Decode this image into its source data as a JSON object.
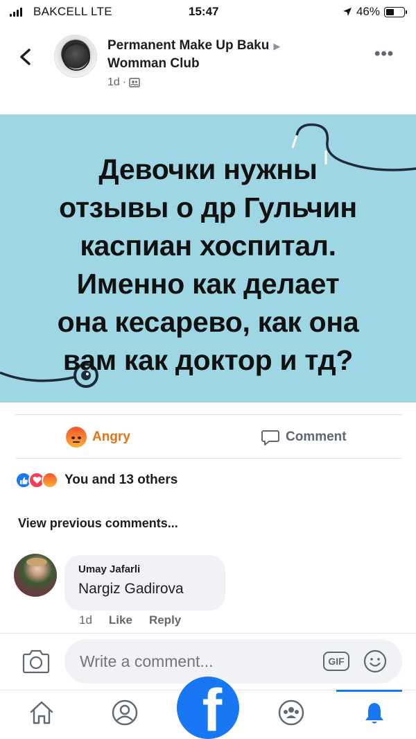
{
  "status_bar": {
    "carrier": "BAKCELL  LTE",
    "time": "15:47",
    "battery_percent": "46%",
    "battery_level": 0.46
  },
  "header": {
    "page_name": "Permanent Make Up Baku",
    "group_name": "Womman Club",
    "time_ago": "1d",
    "separator": "·",
    "more_label": "•••"
  },
  "post": {
    "image_text_lines": [
      "Девочки нужны",
      "отзывы о др Гульчин",
      "каспиан хоспитал.",
      "Именно как делает",
      "она кесарево, как она",
      "вам как доктор и тд?"
    ],
    "background_color": "#9fd6e4"
  },
  "actions": {
    "reaction_label": "Angry",
    "comment_label": "Comment"
  },
  "reactions": {
    "summary": "You and 13 others",
    "types": [
      "like",
      "love",
      "angry"
    ]
  },
  "comments": {
    "view_previous": "View previous comments...",
    "items": [
      {
        "author": "Umay Jafarli",
        "text": "Nargiz Gadirova",
        "time": "1d",
        "like_label": "Like",
        "reply_label": "Reply"
      }
    ]
  },
  "composer": {
    "placeholder": "Write a comment...",
    "gif_label": "GIF"
  },
  "nav": {
    "items": [
      "home-icon",
      "profile-icon",
      "facebook-icon",
      "groups-icon",
      "notifications-icon"
    ],
    "active": "notifications-icon",
    "accent": "#1877f2"
  }
}
